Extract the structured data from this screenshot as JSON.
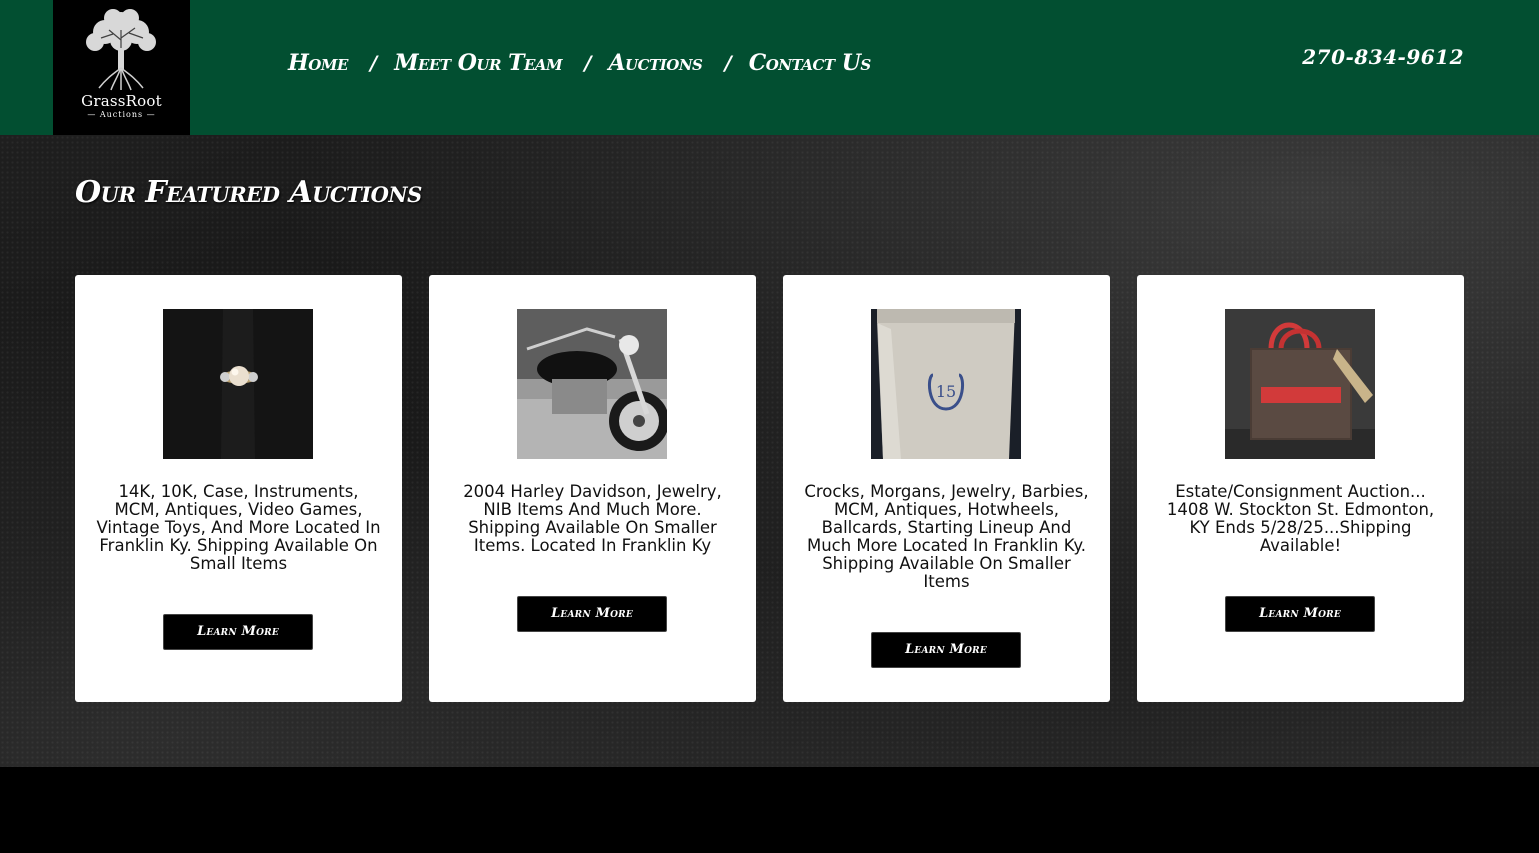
{
  "header": {
    "logo": {
      "name": "GrassRoot",
      "sub": "Auctions"
    },
    "nav": [
      {
        "label": "Home"
      },
      {
        "label": "Meet Our Team"
      },
      {
        "label": "Auctions"
      },
      {
        "label": "Contact Us"
      }
    ],
    "nav_separator": "/",
    "phone": "270-834-9612",
    "bg_color": "#024f31"
  },
  "main": {
    "section_title": "Our Featured Auctions",
    "cards": [
      {
        "image_icon": "pearl-ring-photo",
        "text": "14K, 10K, Case, Instruments, MCM, Antiques, Video Games, Vintage Toys, And More Located In Franklin Ky. Shipping Available On Small Items",
        "button": "Learn More"
      },
      {
        "image_icon": "motorcycle-photo",
        "text": "2004 Harley Davidson, Jewelry, NIB Items And Much More. Shipping Available On Smaller Items. Located In Franklin Ky",
        "button": "Learn More"
      },
      {
        "image_icon": "stoneware-crock-photo",
        "crock_number": "15",
        "text": "Crocks, Morgans, Jewelry, Barbies, MCM, Antiques, Hotwheels, Ballcards, Starting Lineup And Much More Located In Franklin Ky. Shipping Available On Smaller Items",
        "button": "Learn More"
      },
      {
        "image_icon": "tote-bag-photo",
        "text": "Estate/Consignment Auction... 1408 W. Stockton St. Edmonton, KY Ends 5/28/25...Shipping Available!",
        "button": "Learn More"
      }
    ]
  }
}
